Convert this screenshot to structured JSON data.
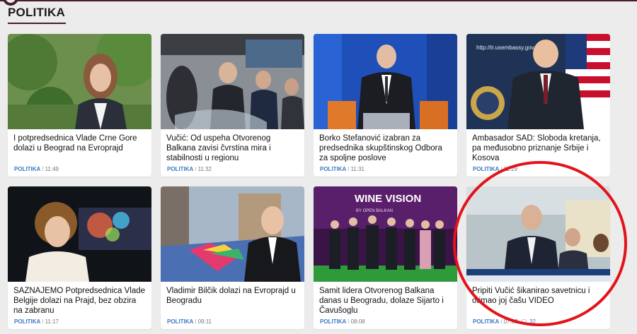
{
  "section": {
    "title": "POLITIKA"
  },
  "cards": [
    {
      "headline": "I potpredsednica Vlade Crne Gore dolazi u Beograd na Evroprajd",
      "category": "POLITIKA",
      "time": "11:49",
      "comments": ""
    },
    {
      "headline": "Vučić: Od uspeha Otvorenog Balkana zavisi čvrstina mira i stabilnosti u regionu",
      "category": "POLITIKA",
      "time": "11:32",
      "comments": ""
    },
    {
      "headline": "Borko Stefanović izabran za predsednika skupštinskog Odbora za spoljne poslove",
      "category": "POLITIKA",
      "time": "11:31",
      "comments": ""
    },
    {
      "headline": "Ambasador SAD: Sloboda kretanja, pa međusobno priznanje Srbije i Kosova",
      "category": "POLITIKA",
      "time": "11:29",
      "comments": ""
    },
    {
      "headline": "SAZNAJEMO Potpredsednica Vlade Belgije dolazi na Prajd, bez obzira na zabranu",
      "category": "POLITIKA",
      "time": "11:17",
      "comments": ""
    },
    {
      "headline": "Vladimir Bilčik dolazi na Evroprajd u Beogradu",
      "category": "POLITIKA",
      "time": "09:11",
      "comments": ""
    },
    {
      "headline": "Samit lidera Otvorenog Balkana danas u Beogradu, dolaze Sijarto i Čavušoglu",
      "category": "POLITIKA",
      "time": "08:08",
      "comments": ""
    },
    {
      "headline": "Pripiti Vučić šikanirao savetnicu i otimao joj čašu VIDEO",
      "category": "POLITIKA",
      "time": "07:03",
      "comments": "32"
    }
  ],
  "image_text": {
    "embassy_url": "http://tr.usembassy.gov",
    "wine_sign": "WINE VISION",
    "wine_sign_sub": "BY OPEN BALKAN"
  },
  "colors": {
    "accent": "#4a1d2e",
    "category": "#3a79c2",
    "highlight_circle": "#e3131b"
  }
}
